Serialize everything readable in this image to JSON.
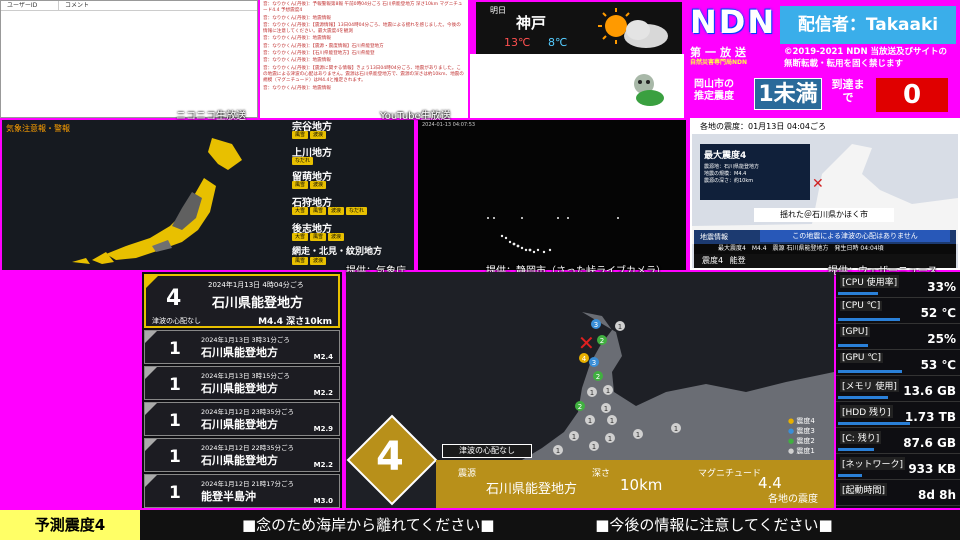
{
  "comments": {
    "col_user": "ユーザーID",
    "col_comment": "コメント"
  },
  "chatlog": [
    "音：なりかくん[丹後]：予報警報第8報 午前0時04分ごろ 石川県能登地方 深さ10km マグニチュード4.4 予想震度4",
    "音：なりかくん[丹後]：地震情報",
    "音：なりかくん[丹後]：【震源情報】13日04時04分ごろ、地震による揺れを感じました。今後の情報に注意してください。最大震度4を観測",
    "音：なりかくん[丹後]：地震情報",
    "音：なりかくん[丹後]：【震源・震度情報】石川県能登地方",
    "音：なりかくん[丹後]：【石川県能登地方】石川県能登",
    "音：なりかくん[丹後]：地震情報",
    "音：なりかくん[丹後]：【震源に関する情報】きょう13日04時04分ごろ、地震がありました。この地震による津波の心配はありません。震源は石川県能登地方で、震源の深さは約10km、地震の規模（マグニチュード）はM4.4と推定されます。",
    "音：なりかくん[丹後]：地震情報"
  ],
  "weather": {
    "label": "明日",
    "city": "神戸",
    "high": "13℃",
    "low": "8℃"
  },
  "header": {
    "logo": "NDN",
    "broadcaster": "配信者：Takaaki",
    "dept": "第一放送",
    "dept_sub": "自然災害専門局NDN",
    "copyright_1": "©2019-2021 NDN 当放送及びサイトの",
    "copyright_2": "無断転載・転用を固く禁じます"
  },
  "intensity": {
    "label": "岡山市の推定震度",
    "value": "1未満",
    "arrive_label": "到達まで",
    "arrive_value": "0"
  },
  "panels": {
    "niconico": "ニコニコ生放送",
    "youtube": "YouTube生放送",
    "jma_src": "提供：気象庁",
    "camera_src": "提供：静岡市（さった峠ライブカメラ）",
    "wn_src": "提供：ウェザーニュース",
    "camera_ts": "2024-01-13 04:07:53"
  },
  "jpmap": {
    "title": "気象注意報・警報",
    "regions": [
      {
        "name": "宗谷地方",
        "badges": [
          "風雪",
          "波浪"
        ]
      },
      {
        "name": "上川地方",
        "badges": [
          "なだれ"
        ]
      },
      {
        "name": "留萌地方",
        "badges": [
          "風雪",
          "波浪"
        ]
      },
      {
        "name": "石狩地方",
        "badges": [
          "大雪",
          "風雪",
          "波浪",
          "なだれ"
        ]
      },
      {
        "name": "後志地方",
        "badges": [
          "大雪",
          "風雪",
          "波浪"
        ]
      },
      {
        "name": "網走・北見・紋別地方",
        "badges": [
          "風雪",
          "波浪"
        ]
      }
    ]
  },
  "tenki": {
    "header": "各地の震度：01月13日 04:04ごろ",
    "max_label": "最大震度4",
    "epicenter": "震源地：石川県能登地方",
    "scale": "地震の規模：M4.4",
    "depth": "震源の深さ：約10km",
    "caption": "揺れた＠石川県かほく市",
    "info_title": "地震情報",
    "tsunami": "この地震による津波の心配はありません",
    "info_max": "最大震度4",
    "info_m": "M4.4",
    "info_region": "震源 石川県能登地方",
    "info_time": "発生日時 04:04頃",
    "footer_scale": "震度4",
    "footer_place": "能登"
  },
  "quakes": {
    "main": {
      "date": "2024年1月13日 4時04分ごろ",
      "scale": "4",
      "place": "石川県能登地方",
      "tsunami": "津波の心配なし",
      "mag": "M4.4 深さ10km"
    },
    "list": [
      {
        "date": "2024年1月13日 3時31分ごろ",
        "scale": "1",
        "place": "石川県能登地方",
        "mag": "M2.4"
      },
      {
        "date": "2024年1月13日 3時15分ごろ",
        "scale": "1",
        "place": "石川県能登地方",
        "mag": "M2.2"
      },
      {
        "date": "2024年1月12日 23時35分ごろ",
        "scale": "1",
        "place": "石川県能登地方",
        "mag": "M2.9"
      },
      {
        "date": "2024年1月12日 22時35分ごろ",
        "scale": "1",
        "place": "石川県能登地方",
        "mag": "M2.2"
      },
      {
        "date": "2024年1月12日 21時17分ごろ",
        "scale": "1",
        "place": "能登半島沖",
        "mag": "M3.0"
      }
    ]
  },
  "eqmap": {
    "scale": "4",
    "tsunami": "津波の心配なし",
    "epicenter_label": "震源",
    "epicenter": "石川県能登地方",
    "depth_label": "深さ",
    "depth": "10km",
    "mag_label": "マグニチュード",
    "mag": "4.4",
    "region_note": "各地の震度",
    "legend": [
      "震度4",
      "震度3",
      "震度2",
      "震度1"
    ]
  },
  "stats": [
    {
      "label": "[CPU 使用率]",
      "value": "33%",
      "fill": 0.33
    },
    {
      "label": "[CPU ℃]",
      "value": "52 ℃",
      "fill": 0.52
    },
    {
      "label": "[GPU]",
      "value": "25%",
      "fill": 0.25
    },
    {
      "label": "[GPU ℃]",
      "value": "53 ℃",
      "fill": 0.53
    },
    {
      "label": "[メモリ 使用]",
      "value": "13.6 GB",
      "fill": 0.42
    },
    {
      "label": "[HDD 残り]",
      "value": "1.73 TB",
      "fill": 0.6
    },
    {
      "label": "[C: 残り]",
      "value": "87.6 GB",
      "fill": 0.3
    },
    {
      "label": "[ネットワーク]",
      "value": "933 KB",
      "fill": 0.2
    },
    {
      "label": "[起動時間]",
      "value": "8d 8h",
      "fill": 0
    }
  ],
  "footer": {
    "pred": "予測震度4",
    "msg1": "■念のため海岸から離れてください■",
    "msg2": "■今後の情報に注意してください■"
  }
}
